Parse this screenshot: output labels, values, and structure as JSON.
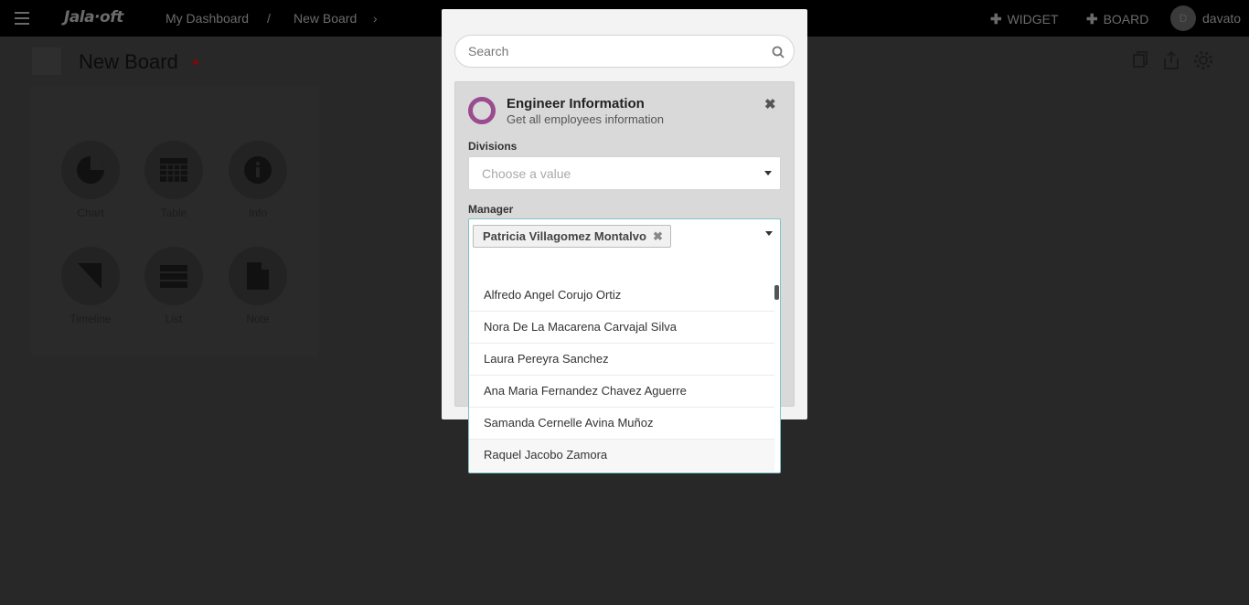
{
  "topbar": {
    "logo": "Jala·oft",
    "breadcrumb": [
      "My Dashboard",
      "/",
      "New Board",
      "›"
    ],
    "widget_label": "WIDGET",
    "board_label": "BOARD",
    "avatar_initial": "D",
    "username": "davato"
  },
  "board": {
    "title": "New Board",
    "widgets": [
      {
        "label": "Chart",
        "icon": "pie-chart-icon"
      },
      {
        "label": "Table",
        "icon": "table-icon"
      },
      {
        "label": "Info",
        "icon": "info-icon"
      },
      {
        "label": "Timeline",
        "icon": "timeline-icon"
      },
      {
        "label": "List",
        "icon": "list-icon"
      },
      {
        "label": "Note",
        "icon": "note-icon"
      }
    ]
  },
  "modal": {
    "search_placeholder": "Search",
    "card": {
      "title": "Engineer Information",
      "subtitle": "Get all employees information",
      "close": "✖",
      "accent": "#9b4b8f"
    },
    "divisions": {
      "label": "Divisions",
      "placeholder": "Choose a value"
    },
    "manager": {
      "label": "Manager",
      "selected": "Patricia Villagomez Montalvo",
      "options": [
        "Alfredo Angel Corujo Ortiz",
        "Nora De La Macarena Carvajal Silva",
        "Laura Pereyra Sanchez",
        "Ana Maria Fernandez Chavez Aguerre",
        "Samanda Cernelle Avina Muñoz",
        "Raquel Jacobo Zamora"
      ]
    }
  }
}
